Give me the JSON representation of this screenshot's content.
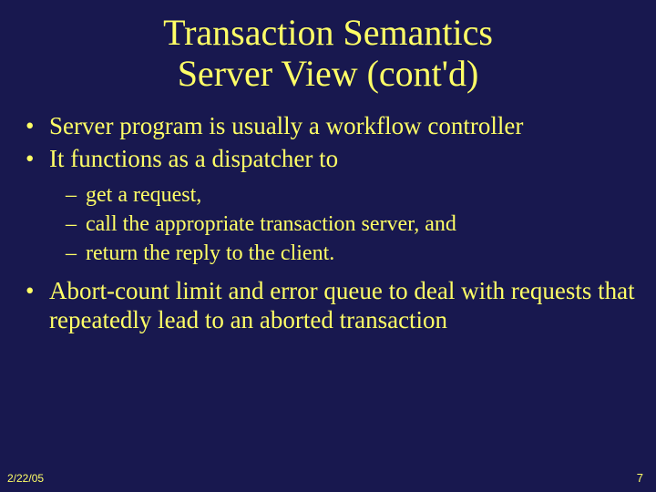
{
  "title": {
    "line1": "Transaction Semantics",
    "line2": "Server View (cont'd)"
  },
  "bullets": {
    "b1": "Server program is usually a workflow controller",
    "b2": "It functions as a dispatcher to",
    "b2_sub": {
      "s1": "get a request,",
      "s2": "call the appropriate transaction server, and",
      "s3": "return the reply to the client."
    },
    "b3": "Abort-count limit and error queue to deal with requests that repeatedly lead to an aborted transaction"
  },
  "footer": {
    "date": "2/22/05",
    "page": "7"
  }
}
